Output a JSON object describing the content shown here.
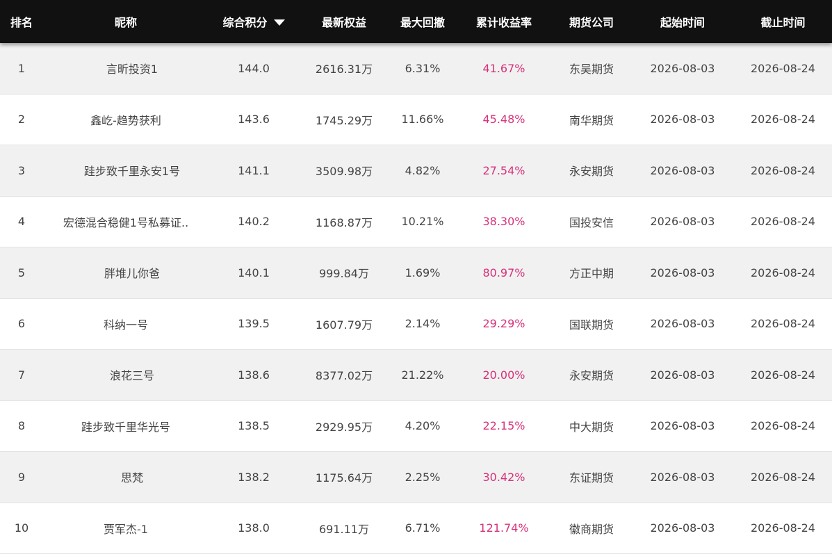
{
  "header": {
    "rank": "排名",
    "name": "昵称",
    "score": "综合积分",
    "equity": "最新权益",
    "drawdown": "最大回撤",
    "return": "累计收益率",
    "company": "期货公司",
    "start": "起始时间",
    "end": "截止时间",
    "sort_icon": "caret-down-icon"
  },
  "colors": {
    "header_bg": "#111111",
    "return_color": "#d6317a",
    "odd_row": "#f1f1f1"
  },
  "rows": [
    {
      "rank": "1",
      "name": "言昕投资1",
      "score": "144.0",
      "equity": "2616.31万",
      "drawdown": "6.31%",
      "return": "41.67%",
      "company": "东吴期货",
      "start": "2026-08-03",
      "end": "2026-08-24"
    },
    {
      "rank": "2",
      "name": "鑫屹-趋势获利",
      "score": "143.6",
      "equity": "1745.29万",
      "drawdown": "11.66%",
      "return": "45.48%",
      "company": "南华期货",
      "start": "2026-08-03",
      "end": "2026-08-24"
    },
    {
      "rank": "3",
      "name": "跬步致千里永安1号",
      "score": "141.1",
      "equity": "3509.98万",
      "drawdown": "4.82%",
      "return": "27.54%",
      "company": "永安期货",
      "start": "2026-08-03",
      "end": "2026-08-24"
    },
    {
      "rank": "4",
      "name": "宏德混合稳健1号私募证..",
      "score": "140.2",
      "equity": "1168.87万",
      "drawdown": "10.21%",
      "return": "38.30%",
      "company": "国投安信",
      "start": "2026-08-03",
      "end": "2026-08-24"
    },
    {
      "rank": "5",
      "name": "胖堆儿你爸",
      "score": "140.1",
      "equity": "999.84万",
      "drawdown": "1.69%",
      "return": "80.97%",
      "company": "方正中期",
      "start": "2026-08-03",
      "end": "2026-08-24"
    },
    {
      "rank": "6",
      "name": "科纳一号",
      "score": "139.5",
      "equity": "1607.79万",
      "drawdown": "2.14%",
      "return": "29.29%",
      "company": "国联期货",
      "start": "2026-08-03",
      "end": "2026-08-24"
    },
    {
      "rank": "7",
      "name": "浪花三号",
      "score": "138.6",
      "equity": "8377.02万",
      "drawdown": "21.22%",
      "return": "20.00%",
      "company": "永安期货",
      "start": "2026-08-03",
      "end": "2026-08-24"
    },
    {
      "rank": "8",
      "name": "跬步致千里华光号",
      "score": "138.5",
      "equity": "2929.95万",
      "drawdown": "4.20%",
      "return": "22.15%",
      "company": "中大期货",
      "start": "2026-08-03",
      "end": "2026-08-24"
    },
    {
      "rank": "9",
      "name": "思梵",
      "score": "138.2",
      "equity": "1175.64万",
      "drawdown": "2.25%",
      "return": "30.42%",
      "company": "东证期货",
      "start": "2026-08-03",
      "end": "2026-08-24"
    },
    {
      "rank": "10",
      "name": "贾军杰-1",
      "score": "138.0",
      "equity": "691.11万",
      "drawdown": "6.71%",
      "return": "121.74%",
      "company": "徽商期货",
      "start": "2026-08-03",
      "end": "2026-08-24"
    }
  ]
}
